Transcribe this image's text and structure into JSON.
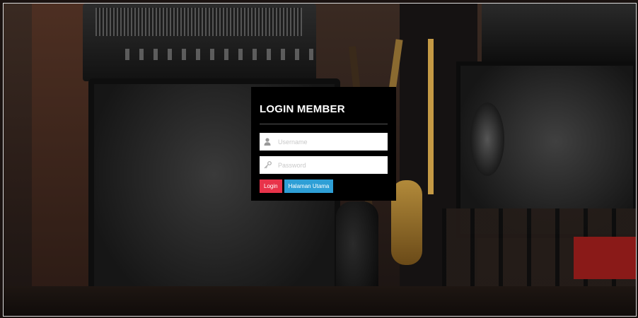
{
  "login": {
    "title": "LOGIN MEMBER",
    "username": {
      "placeholder": "Username",
      "value": "",
      "icon": "user-icon"
    },
    "password": {
      "placeholder": "Password",
      "value": "",
      "icon": "key-icon"
    },
    "login_label": "Login",
    "home_label": "Halaman Utama"
  },
  "colors": {
    "panel_bg": "#000000",
    "login_button": "#e8334a",
    "home_button": "#2e9fd6"
  }
}
